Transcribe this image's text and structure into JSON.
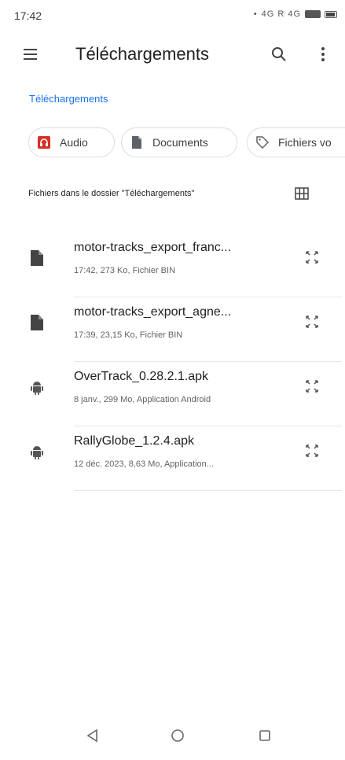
{
  "status_bar": {
    "time": "17:42",
    "indicators": "4G R 4G"
  },
  "app_bar": {
    "title": "Téléchargements",
    "menu_icon": "hamburger-menu-icon",
    "search_icon": "search-icon",
    "more_icon": "more-vert-icon"
  },
  "breadcrumb": {
    "label": "Téléchargements",
    "color": "#1a73e8"
  },
  "chips": [
    {
      "label": "Audio",
      "icon": "audio-icon",
      "icon_color": "#d93025"
    },
    {
      "label": "Documents",
      "icon": "document-icon",
      "icon_color": "#5f6368"
    },
    {
      "label": "Fichiers vo",
      "icon": "tag-icon",
      "icon_color": "#5f6368"
    }
  ],
  "section": {
    "header": "Fichiers dans le dossier \"Téléchargements\"",
    "view_icon": "grid-view-icon"
  },
  "files": [
    {
      "name": "motor-tracks_export_franc...",
      "meta": "17:42, 273 Ko, Fichier BIN",
      "icon": "file-icon"
    },
    {
      "name": "motor-tracks_export_agne...",
      "meta": "17:39, 23,15 Ko, Fichier BIN",
      "icon": "file-icon"
    },
    {
      "name": "OverTrack_0.28.2.1.apk",
      "meta": "8 janv., 299 Mo, Application Android",
      "icon": "android-icon"
    },
    {
      "name": "RallyGlobe_1.2.4.apk",
      "meta": "12 déc. 2023, 8,63 Mo, Application...",
      "icon": "android-icon"
    }
  ],
  "nav_bar": {
    "back_icon": "back-triangle-icon",
    "home_icon": "home-circle-icon",
    "recents_icon": "recents-square-icon"
  }
}
